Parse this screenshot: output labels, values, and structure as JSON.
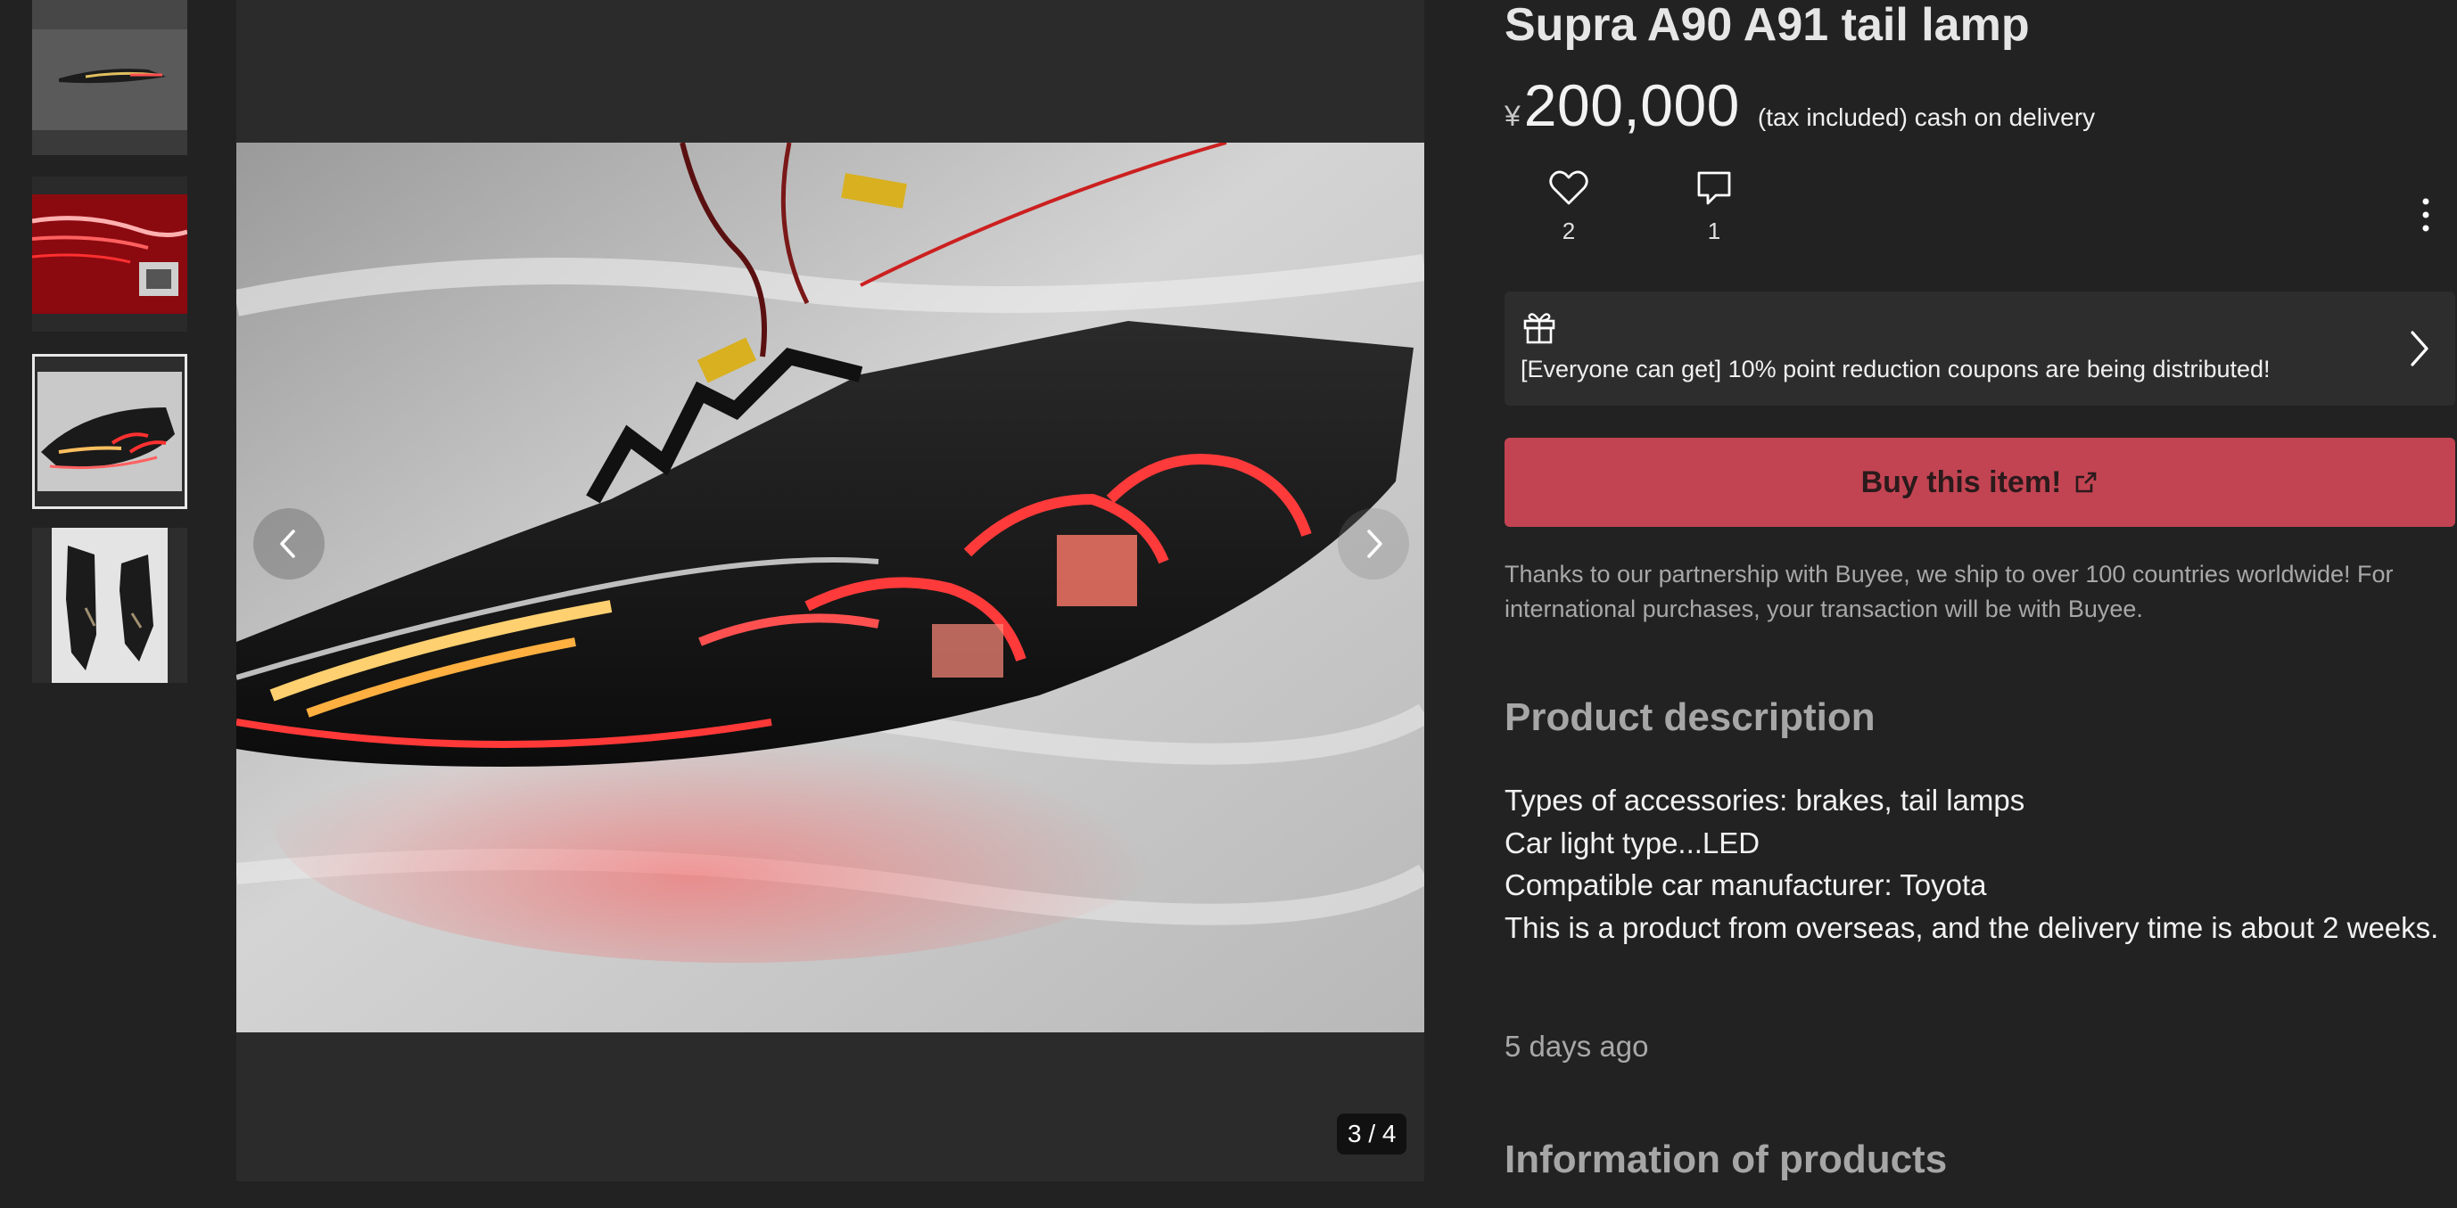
{
  "product": {
    "title": "Supra A90 A91 tail lamp",
    "currency": "¥",
    "price": "200,000",
    "price_note": "(tax included) cash on delivery",
    "likes": "2",
    "comments": "1"
  },
  "coupon": {
    "text": "[Everyone can get] 10% point reduction coupons are being distributed!"
  },
  "buy": {
    "label": "Buy this item!"
  },
  "partner_note": "Thanks to our partnership with Buyee, we ship to over 100 countries worldwide! For international purchases, your transaction will be with Buyee.",
  "description": {
    "heading": "Product description",
    "lines": [
      "Types of accessories: brakes, tail lamps",
      "Car light type...LED",
      "Compatible car manufacturer: Toyota",
      "This is a product from overseas, and the delivery time is about 2 weeks."
    ],
    "posted": "5 days ago"
  },
  "info_heading": "Information of products",
  "gallery": {
    "counter": "3 / 4",
    "current": 3,
    "total": 4
  },
  "icons": {
    "like": "heart-icon",
    "comment": "comment-icon",
    "more": "more-vertical-icon",
    "gift": "gift-icon",
    "external": "external-link-icon",
    "prev": "chevron-left-icon",
    "next": "chevron-right-icon"
  },
  "colors": {
    "background": "#222222",
    "buy_button": "#c24452",
    "muted_text": "#a8a8a8"
  }
}
